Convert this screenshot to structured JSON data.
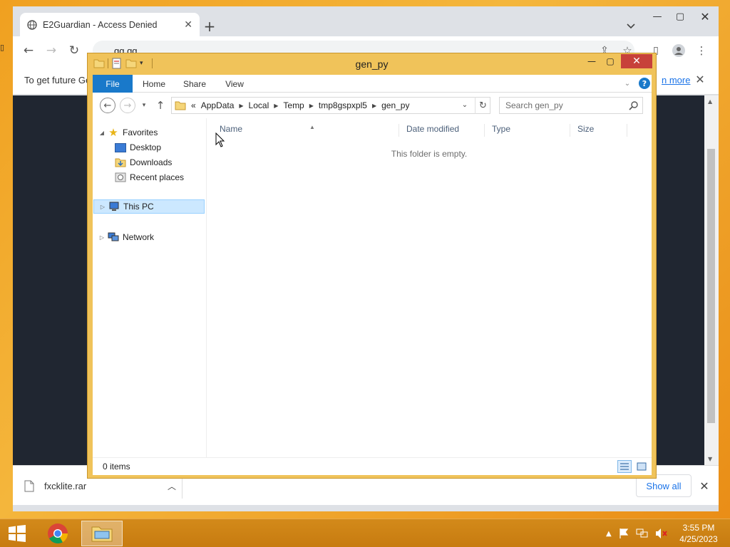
{
  "chrome": {
    "tab_title": "E2Guardian - Access Denied",
    "address": "gg.gg",
    "infobar_text": "To get future Ge",
    "infobar_link": "n more",
    "download_filename": "fxcklite.rar",
    "show_all_label": "Show all"
  },
  "explorer": {
    "title": "gen_py",
    "ribbon_tabs": [
      "File",
      "Home",
      "Share",
      "View"
    ],
    "breadcrumb_prefix": "«",
    "breadcrumb": [
      "AppData",
      "Local",
      "Temp",
      "tmp8gspxpl5",
      "gen_py"
    ],
    "search_placeholder": "Search gen_py",
    "nav": {
      "favorites": "Favorites",
      "desktop": "Desktop",
      "downloads": "Downloads",
      "recent_places": "Recent places",
      "this_pc": "This PC",
      "network": "Network"
    },
    "columns": [
      "Name",
      "Date modified",
      "Type",
      "Size"
    ],
    "empty_message": "This folder is empty.",
    "status": "0 items"
  },
  "taskbar": {
    "time": "3:55 PM",
    "date": "4/25/2023"
  },
  "colors": {
    "accent_blue": "#1979ca",
    "window_frame": "#f0c35a",
    "close_red": "#c7413a",
    "taskbar": "#c77b10"
  }
}
